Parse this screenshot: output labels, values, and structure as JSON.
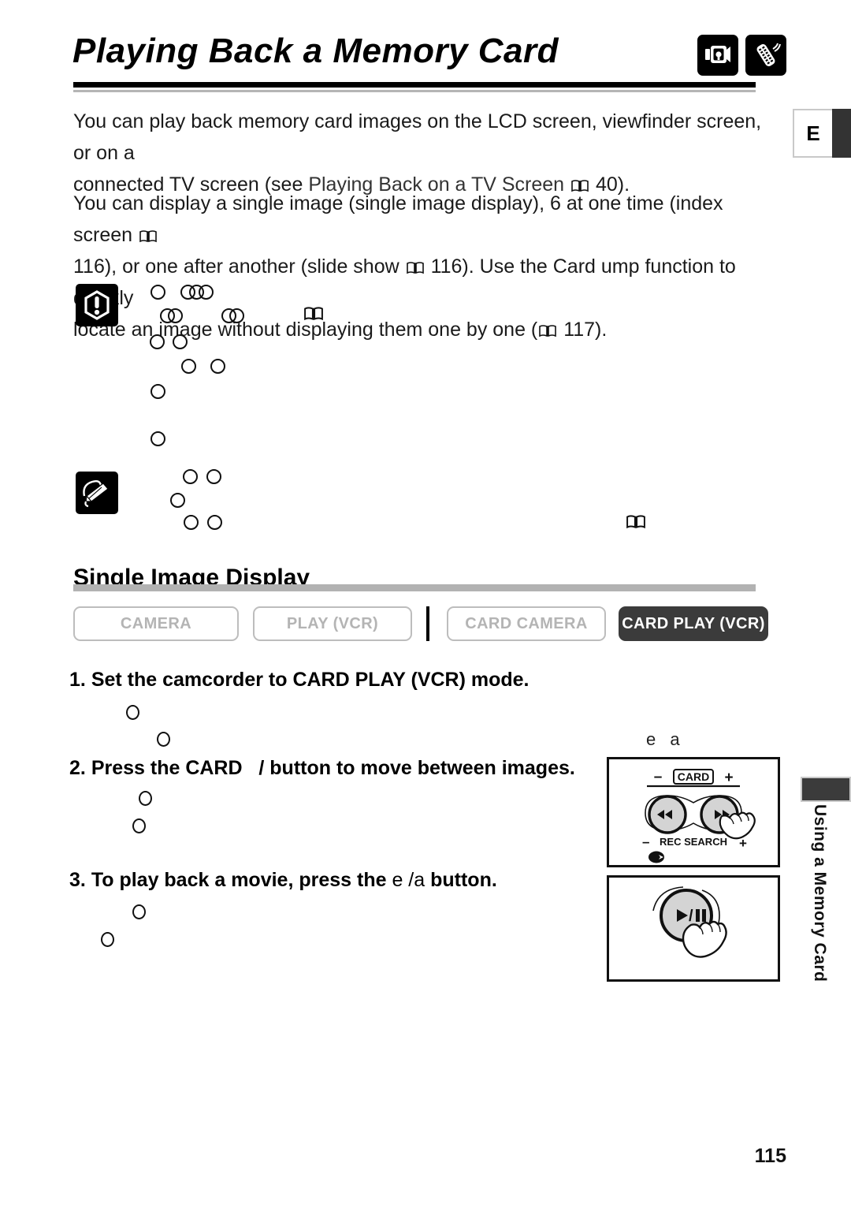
{
  "header": {
    "title": "Playing Back a Memory Card",
    "icons": [
      {
        "name": "camcorder-icon",
        "label": "camcorder"
      },
      {
        "name": "remote-control-icon",
        "label": "wireless controller"
      }
    ],
    "language_tab": "E"
  },
  "body": {
    "paragraph_1_a": "You can play back memory card images on the LCD screen, viewfinder screen, or on a",
    "paragraph_1_b_pre": "connected TV screen (see ",
    "paragraph_1_b_ref": "Playing Back on a TV Screen",
    "paragraph_1_b_page": "40).",
    "paragraph_2_a": "You can display a single image (single image display), 6 at one time (index screen",
    "paragraph_2_b_pre": "116), or one after another (slide show",
    "paragraph_2_b_mid": "116). Use the Card  ump function to quickly",
    "paragraph_2_c_pre": "locate an image without displaying them one by one (",
    "paragraph_2_c_page": "117)."
  },
  "notes": {
    "warning_icon": "warning-exclamation-icon",
    "notes_icon": "notes-pencil-icon"
  },
  "section": {
    "heading": "Single Image Display",
    "modes": [
      {
        "label": "CAMERA",
        "active": false
      },
      {
        "label": "PLAY (VCR)",
        "active": false
      },
      {
        "label": "CARD CAMERA",
        "active": false
      },
      {
        "label": "CARD PLAY (VCR)",
        "active": true
      }
    ],
    "active_mode_color": "#3b3b3b"
  },
  "steps": [
    {
      "number": "1.",
      "text": "Set the camcorder to CARD PLAY (VCR) mode."
    },
    {
      "number": "2.",
      "text_a": "Press the CARD",
      "text_b": "/ button to move between images."
    },
    {
      "number": "3.",
      "text_a": "To play back a movie, press the",
      "glyph": "e /a",
      "text_b": "button."
    }
  ],
  "illustrations": {
    "caption": "e  a",
    "box1": {
      "name": "card-rec-search-buttons-illustration",
      "card_label": "CARD",
      "minus": "–",
      "plus": "+",
      "rec_search_label": "REC SEARCH",
      "rewind_glyph": "◀◀",
      "forward_glyph": "▶▶"
    },
    "box2": {
      "name": "play-pause-button-illustration",
      "play_pause_label": "▶/❙❙"
    }
  },
  "sidebar": {
    "tab_text": "Using a Memory Card",
    "marker_color": "#3b3b3b"
  },
  "footer": {
    "page_number": "115"
  }
}
